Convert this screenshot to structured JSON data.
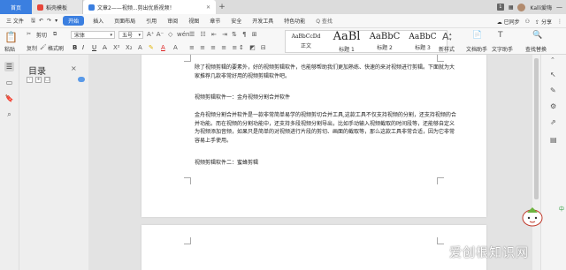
{
  "tabs": {
    "home": "首页",
    "doc1": "稻壳模板",
    "doc2": "文章2——视频...剪出优质视频！",
    "new": "+",
    "badge": "1",
    "user": "Kalli爱嗨"
  },
  "menu": {
    "file": "三 文件",
    "start": "开始",
    "items": [
      "插入",
      "页面布局",
      "引用",
      "审阅",
      "视图",
      "章节",
      "安全",
      "开发工具",
      "特色功能"
    ],
    "search": "Q 查找",
    "sync": "已同步",
    "share": "分享"
  },
  "ribbon": {
    "paste": "粘贴",
    "cut": "剪切",
    "copy": "复制",
    "format_painter": "格式刷",
    "font_name": "宋体",
    "font_size": "五号",
    "bold": "B",
    "italic": "I",
    "underline": "U",
    "styles": [
      {
        "sample": "AaBbCcDd",
        "name": "正文",
        "size": 6
      },
      {
        "sample": "AaBl",
        "name": "标题 1",
        "size": 13
      },
      {
        "sample": "AaBbC",
        "name": "标题 2",
        "size": 10
      },
      {
        "sample": "AaBbC",
        "name": "标题 3",
        "size": 9
      }
    ],
    "new_style": "新样式",
    "text_assistant": "文字助手",
    "doc_assistant": "文档助手",
    "find_replace": "查找替换"
  },
  "outline": {
    "title": "目录",
    "close": "×",
    "buttons": [
      "-",
      "+",
      "□"
    ]
  },
  "document": {
    "paragraphs": [
      "除了视频剪辑的要素外，好的视频剪辑软件，也能够帮助我们更加熟练、快速的来对视频进行剪辑。下面就为大家推荐几款非常好用的视频剪辑软件吧。",
      "视频剪辑软件一：金舟视频分割合并软件",
      "金舟视频分割合并软件是一款非常简单易学的视频剪切合并工具,这款工具不仅支持视频的分割，还支持视频的合并功能。而在视频的分割功能中，还支持多段视频分割导出，比如手动输入视频截取的时间段等，还能够自定义为视频添加音频，如果只是简单的对视频进行片段的剪切、画面的截取等，那么这款工具非常合适，因为它非常容易上手使用。",
      "视频剪辑软件二：蜜蜂剪辑"
    ]
  },
  "colors": {
    "accent": "#3b7fe0",
    "home_tab": "#3b7fe0"
  },
  "watermark": "爱创根知识网"
}
